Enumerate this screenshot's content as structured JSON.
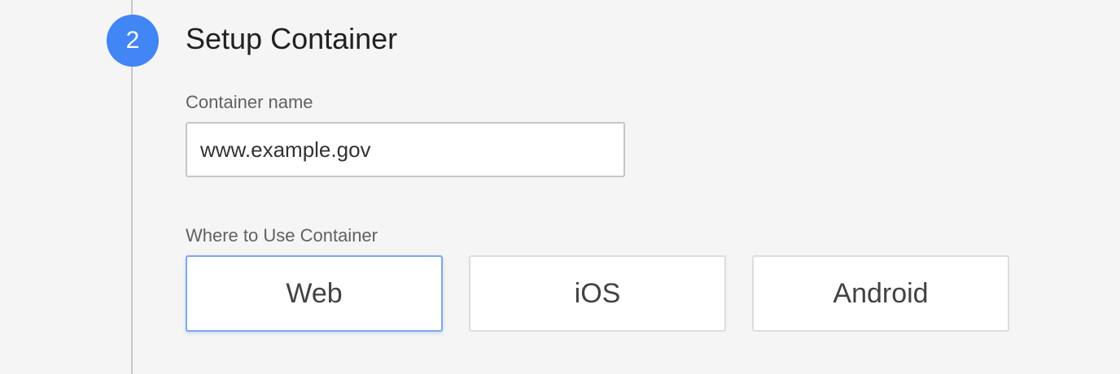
{
  "step": {
    "number": "2",
    "title": "Setup Container"
  },
  "container_name": {
    "label": "Container name",
    "value": "www.example.gov"
  },
  "where_to_use": {
    "label": "Where to Use Container",
    "options": [
      {
        "label": "Web",
        "selected": true
      },
      {
        "label": "iOS",
        "selected": false
      },
      {
        "label": "Android",
        "selected": false
      }
    ]
  },
  "colors": {
    "accent": "#4285f4",
    "selected_border": "#7ea8f0",
    "background": "#f5f5f5"
  }
}
